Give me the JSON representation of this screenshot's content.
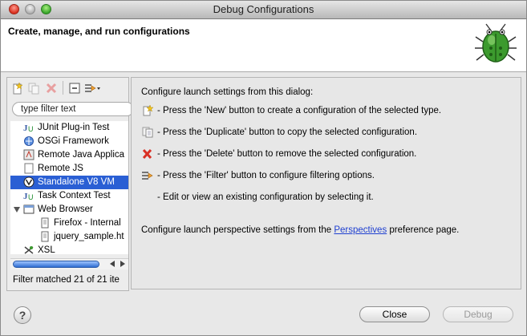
{
  "window": {
    "title": "Debug Configurations"
  },
  "header": {
    "title": "Create, manage, and run configurations"
  },
  "filter": {
    "placeholder": "type filter text"
  },
  "tree": {
    "items": [
      {
        "label": "JUnit Plug-in Test",
        "icon": "junit-plugin-icon",
        "indent": 1,
        "selected": false
      },
      {
        "label": "OSGi Framework",
        "icon": "osgi-icon",
        "indent": 1,
        "selected": false
      },
      {
        "label": "Remote Java Applica",
        "icon": "remote-java-icon",
        "indent": 1,
        "selected": false
      },
      {
        "label": "Remote JS",
        "icon": "remote-js-icon",
        "indent": 1,
        "selected": false
      },
      {
        "label": "Standalone V8 VM",
        "icon": "v8-icon",
        "indent": 1,
        "selected": true
      },
      {
        "label": "Task Context Test",
        "icon": "task-context-icon",
        "indent": 1,
        "selected": false
      },
      {
        "label": "Web Browser",
        "icon": "web-browser-icon",
        "indent": 1,
        "selected": false,
        "expanded": true
      },
      {
        "label": "Firefox - Internal",
        "icon": "file-icon",
        "indent": 2,
        "selected": false
      },
      {
        "label": "jquery_sample.ht",
        "icon": "file-icon",
        "indent": 2,
        "selected": false
      },
      {
        "label": "XSL",
        "icon": "xsl-icon",
        "indent": 1,
        "selected": false
      }
    ]
  },
  "status": {
    "text": "Filter matched 21 of 21 ite"
  },
  "help_panel": {
    "intro": "Configure launch settings from this dialog:",
    "lines": [
      {
        "icon": "new-icon",
        "text": "- Press the 'New' button to create a configuration of the selected type."
      },
      {
        "icon": "duplicate-icon",
        "text": "- Press the 'Duplicate' button to copy the selected configuration."
      },
      {
        "icon": "delete-icon",
        "text": "- Press the 'Delete' button to remove the selected configuration."
      },
      {
        "icon": "filter-icon",
        "text": "- Press the 'Filter' button to configure filtering options."
      },
      {
        "icon": "",
        "text": "- Edit or view an existing configuration by selecting it."
      }
    ],
    "perspective_prefix": "Configure launch perspective settings from the ",
    "perspective_link": "Perspectives",
    "perspective_suffix": " preference page."
  },
  "buttons": {
    "help": "?",
    "close": "Close",
    "debug": "Debug"
  },
  "colors": {
    "selection": "#2a5fd4",
    "link": "#1e3fd0"
  }
}
